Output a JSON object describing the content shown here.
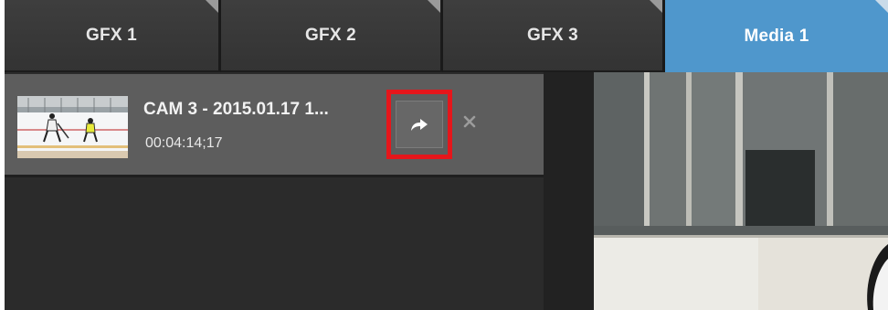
{
  "tabs": [
    {
      "label": "GFX 1",
      "active": false
    },
    {
      "label": "GFX 2",
      "active": false
    },
    {
      "label": "GFX 3",
      "active": false
    },
    {
      "label": "Media 1",
      "active": true
    }
  ],
  "media_items": [
    {
      "title": "CAM 3 - 2015.01.17 1...",
      "duration": "00:04:14;17",
      "thumbnail": "hockey-rink-thumbnail",
      "actions": [
        "send-arrow-icon",
        "close-icon"
      ]
    }
  ],
  "preview": {
    "content": "video-preview"
  },
  "colors": {
    "active_tab": "#4f97cc",
    "highlight": "#e5161b",
    "item_bg": "#5d5d5d"
  }
}
